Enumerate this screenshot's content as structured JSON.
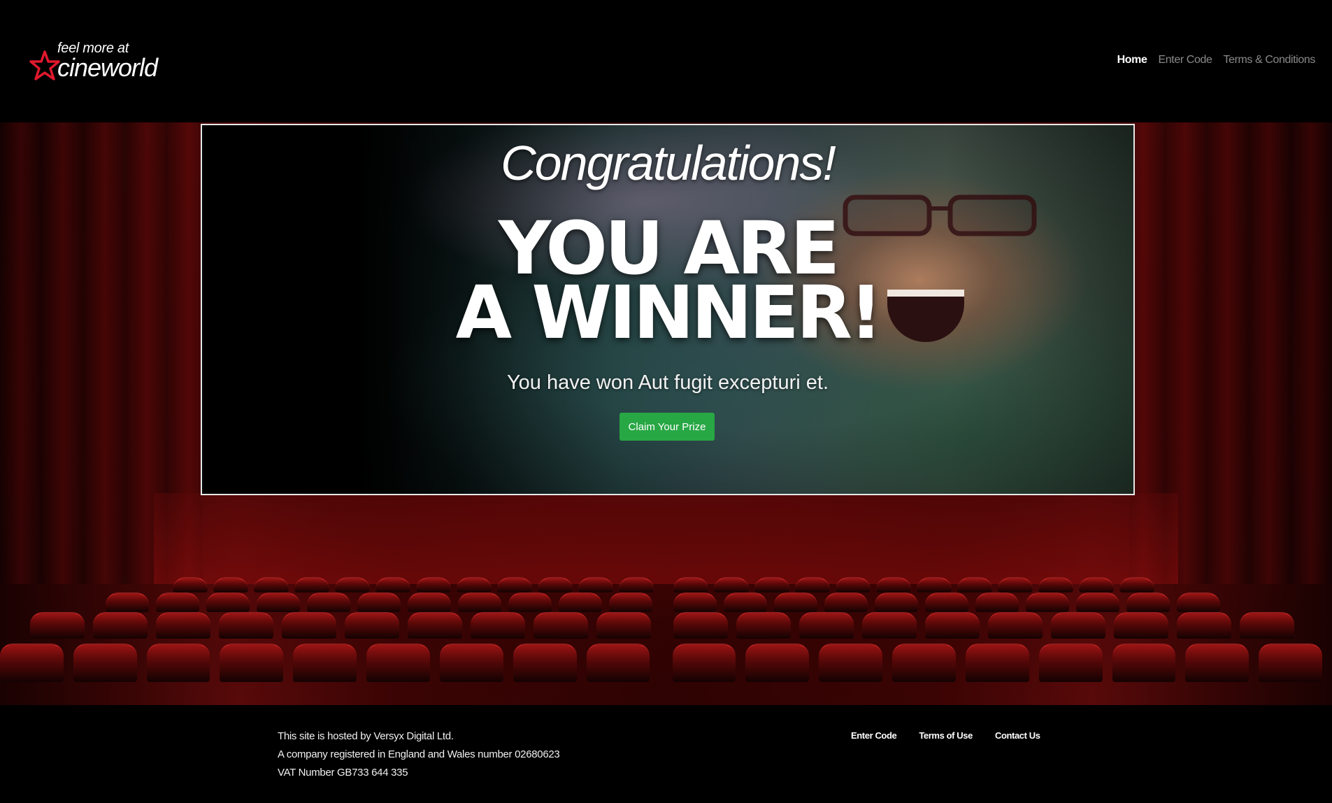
{
  "header": {
    "logo_tagline": "feel more at",
    "logo_name": "cineworld",
    "nav": [
      {
        "label": "Home",
        "active": true
      },
      {
        "label": "Enter Code",
        "active": false
      },
      {
        "label": "Terms & Conditions",
        "active": false
      }
    ]
  },
  "hero": {
    "congrats": "Congratulations!",
    "winner_line1": "YOU ARE",
    "winner_line2": "A WINNER!",
    "won_text": "You have won Aut fugit excepturi et.",
    "claim_button": "Claim Your Prize"
  },
  "footer": {
    "hosted": "This site is hosted by Versyx Digital Ltd.",
    "company": "A company registered in England and Wales number 02680623",
    "vat": "VAT Number GB733 644 335",
    "links": [
      "Enter Code",
      "Terms of Use",
      "Contact Us"
    ]
  },
  "colors": {
    "background": "#000000",
    "accent_red": "#e0182d",
    "claim_button": "#28a745",
    "nav_inactive": "#8a8a8a"
  }
}
